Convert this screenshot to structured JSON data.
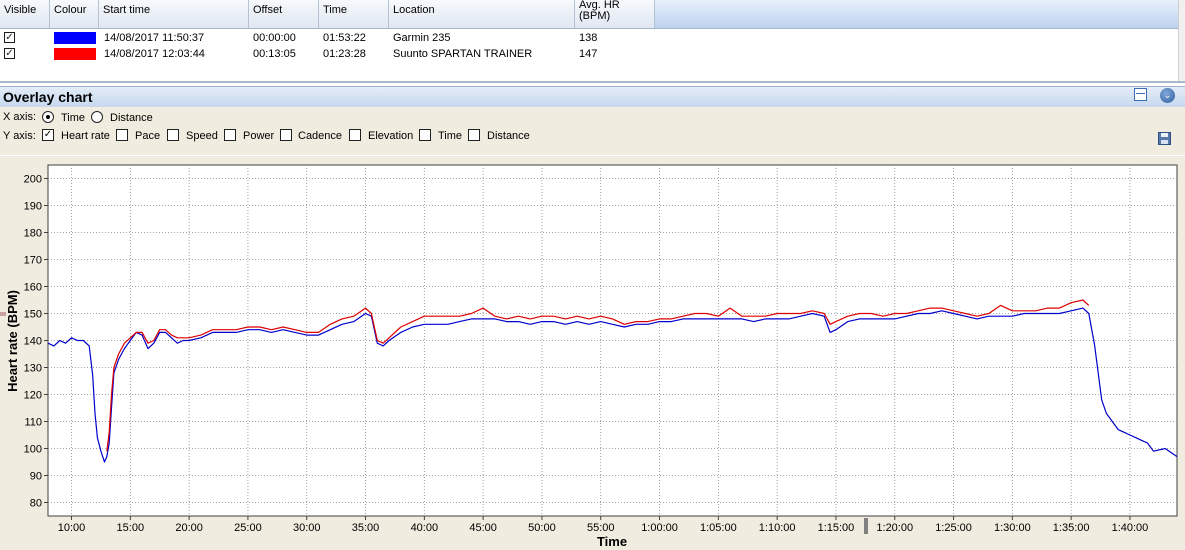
{
  "table": {
    "columns": [
      "Visible",
      "Colour",
      "Start time",
      "Offset",
      "Time",
      "Location",
      "Avg. HR\n(BPM)"
    ],
    "rows": [
      {
        "visible": true,
        "colour": "#0000ff",
        "start_time": "14/08/2017 11:50:37",
        "offset": "00:00:00",
        "time": "01:53:22",
        "location": "Garmin 235",
        "avg_hr": "138"
      },
      {
        "visible": true,
        "colour": "#ff0000",
        "start_time": "14/08/2017 12:03:44",
        "offset": "00:13:05",
        "time": "01:23:28",
        "location": "Suunto SPARTAN TRAINER",
        "avg_hr": "147"
      }
    ]
  },
  "panel": {
    "title": "Overlay chart",
    "x_axis_label": "X axis:",
    "x_axis_options": [
      {
        "label": "Time",
        "selected": true
      },
      {
        "label": "Distance",
        "selected": false
      }
    ],
    "y_axis_label": "Y axis:",
    "y_axis_options": [
      {
        "label": "Heart rate",
        "checked": true
      },
      {
        "label": "Pace",
        "checked": false
      },
      {
        "label": "Speed",
        "checked": false
      },
      {
        "label": "Power",
        "checked": false
      },
      {
        "label": "Cadence",
        "checked": false
      },
      {
        "label": "Elevation",
        "checked": false
      },
      {
        "label": "Time",
        "checked": false
      },
      {
        "label": "Distance",
        "checked": false
      }
    ],
    "icons": [
      "layout-icon",
      "collapse-icon",
      "save-icon"
    ]
  },
  "chart_data": {
    "type": "line",
    "xlabel": "Time",
    "ylabel": "Heart rate (BPM)",
    "xlim_min": [
      8,
      104
    ],
    "ylim": [
      75,
      205
    ],
    "y_ticks": [
      80,
      90,
      100,
      110,
      120,
      130,
      140,
      150,
      160,
      170,
      180,
      190,
      200
    ],
    "x_ticks": [
      {
        "v": 10,
        "label": "10:00"
      },
      {
        "v": 15,
        "label": "15:00"
      },
      {
        "v": 20,
        "label": "20:00"
      },
      {
        "v": 25,
        "label": "25:00"
      },
      {
        "v": 30,
        "label": "30:00"
      },
      {
        "v": 35,
        "label": "35:00"
      },
      {
        "v": 40,
        "label": "40:00"
      },
      {
        "v": 45,
        "label": "45:00"
      },
      {
        "v": 50,
        "label": "50:00"
      },
      {
        "v": 55,
        "label": "55:00"
      },
      {
        "v": 60,
        "label": "1:00:00"
      },
      {
        "v": 65,
        "label": "1:05:00"
      },
      {
        "v": 70,
        "label": "1:10:00"
      },
      {
        "v": 75,
        "label": "1:15:00"
      },
      {
        "v": 80,
        "label": "1:20:00"
      },
      {
        "v": 85,
        "label": "1:25:00"
      },
      {
        "v": 90,
        "label": "1:30:00"
      },
      {
        "v": 95,
        "label": "1:35:00"
      },
      {
        "v": 100,
        "label": "1:40:00"
      }
    ],
    "grid": true,
    "series": [
      {
        "color": "#0000cc",
        "points": [
          [
            8,
            139
          ],
          [
            8.5,
            138
          ],
          [
            9,
            140
          ],
          [
            9.5,
            139
          ],
          [
            10,
            141
          ],
          [
            10.5,
            140
          ],
          [
            11,
            140
          ],
          [
            11.5,
            138
          ],
          [
            11.8,
            127
          ],
          [
            12,
            113
          ],
          [
            12.2,
            104
          ],
          [
            12.5,
            99
          ],
          [
            12.8,
            95
          ],
          [
            13,
            97
          ],
          [
            13.2,
            102
          ],
          [
            13.4,
            115
          ],
          [
            13.6,
            128
          ],
          [
            14,
            133
          ],
          [
            14.5,
            137
          ],
          [
            15,
            140
          ],
          [
            15.5,
            143
          ],
          [
            16,
            142
          ],
          [
            16.5,
            137
          ],
          [
            17,
            139
          ],
          [
            17.5,
            143
          ],
          [
            18,
            143
          ],
          [
            18.5,
            141
          ],
          [
            19,
            139
          ],
          [
            19.5,
            140
          ],
          [
            20,
            140
          ],
          [
            21,
            141
          ],
          [
            22,
            143
          ],
          [
            23,
            143
          ],
          [
            24,
            143
          ],
          [
            25,
            144
          ],
          [
            26,
            144
          ],
          [
            27,
            143
          ],
          [
            28,
            144
          ],
          [
            29,
            143
          ],
          [
            30,
            142
          ],
          [
            31,
            142
          ],
          [
            32,
            144
          ],
          [
            33,
            146
          ],
          [
            34,
            147
          ],
          [
            35,
            150
          ],
          [
            35.5,
            149
          ],
          [
            36,
            139
          ],
          [
            36.5,
            138
          ],
          [
            37,
            140
          ],
          [
            38,
            143
          ],
          [
            39,
            145
          ],
          [
            40,
            146
          ],
          [
            41,
            146
          ],
          [
            42,
            146
          ],
          [
            43,
            147
          ],
          [
            44,
            148
          ],
          [
            45,
            148
          ],
          [
            46,
            148
          ],
          [
            47,
            147
          ],
          [
            48,
            147
          ],
          [
            49,
            146
          ],
          [
            50,
            147
          ],
          [
            51,
            147
          ],
          [
            52,
            146
          ],
          [
            53,
            147
          ],
          [
            54,
            146
          ],
          [
            55,
            147
          ],
          [
            56,
            146
          ],
          [
            57,
            145
          ],
          [
            58,
            146
          ],
          [
            59,
            146
          ],
          [
            60,
            147
          ],
          [
            61,
            147
          ],
          [
            62,
            148
          ],
          [
            63,
            148
          ],
          [
            64,
            148
          ],
          [
            65,
            148
          ],
          [
            66,
            148
          ],
          [
            67,
            148
          ],
          [
            68,
            147
          ],
          [
            69,
            148
          ],
          [
            70,
            148
          ],
          [
            71,
            148
          ],
          [
            72,
            149
          ],
          [
            73,
            150
          ],
          [
            74,
            149
          ],
          [
            74.5,
            143
          ],
          [
            75,
            144
          ],
          [
            76,
            147
          ],
          [
            77,
            148
          ],
          [
            78,
            148
          ],
          [
            79,
            148
          ],
          [
            80,
            148
          ],
          [
            81,
            149
          ],
          [
            82,
            150
          ],
          [
            83,
            150
          ],
          [
            84,
            151
          ],
          [
            85,
            150
          ],
          [
            86,
            149
          ],
          [
            87,
            148
          ],
          [
            88,
            149
          ],
          [
            89,
            149
          ],
          [
            90,
            149
          ],
          [
            91,
            150
          ],
          [
            92,
            150
          ],
          [
            93,
            150
          ],
          [
            94,
            150
          ],
          [
            95,
            151
          ],
          [
            96,
            152
          ],
          [
            96.5,
            150
          ],
          [
            97,
            138
          ],
          [
            97.3,
            128
          ],
          [
            97.6,
            118
          ],
          [
            98,
            113
          ],
          [
            98.5,
            110
          ],
          [
            99,
            107
          ],
          [
            99.5,
            106
          ],
          [
            100,
            105
          ],
          [
            100.5,
            104
          ],
          [
            101,
            103
          ],
          [
            101.5,
            102
          ],
          [
            102,
            99
          ],
          [
            103,
            100
          ],
          [
            104,
            97
          ]
        ]
      },
      {
        "color": "#dd0000",
        "points": [
          [
            13,
            99
          ],
          [
            13.2,
            106
          ],
          [
            13.4,
            120
          ],
          [
            13.6,
            130
          ],
          [
            14,
            135
          ],
          [
            14.5,
            139
          ],
          [
            15,
            141
          ],
          [
            15.5,
            143
          ],
          [
            16,
            143
          ],
          [
            16.5,
            139
          ],
          [
            17,
            140
          ],
          [
            17.5,
            144
          ],
          [
            18,
            144
          ],
          [
            18.5,
            142
          ],
          [
            19,
            141
          ],
          [
            19.5,
            141
          ],
          [
            20,
            141
          ],
          [
            21,
            142
          ],
          [
            22,
            144
          ],
          [
            23,
            144
          ],
          [
            24,
            144
          ],
          [
            25,
            145
          ],
          [
            26,
            145
          ],
          [
            27,
            144
          ],
          [
            28,
            145
          ],
          [
            29,
            144
          ],
          [
            30,
            143
          ],
          [
            31,
            143
          ],
          [
            32,
            146
          ],
          [
            33,
            148
          ],
          [
            34,
            149
          ],
          [
            35,
            152
          ],
          [
            35.5,
            150
          ],
          [
            36,
            140
          ],
          [
            36.5,
            139
          ],
          [
            37,
            141
          ],
          [
            38,
            145
          ],
          [
            39,
            147
          ],
          [
            40,
            149
          ],
          [
            41,
            149
          ],
          [
            42,
            149
          ],
          [
            43,
            149
          ],
          [
            44,
            150
          ],
          [
            45,
            152
          ],
          [
            46,
            149
          ],
          [
            47,
            148
          ],
          [
            48,
            149
          ],
          [
            49,
            148
          ],
          [
            50,
            149
          ],
          [
            51,
            149
          ],
          [
            52,
            148
          ],
          [
            53,
            149
          ],
          [
            54,
            148
          ],
          [
            55,
            149
          ],
          [
            56,
            148
          ],
          [
            57,
            146
          ],
          [
            58,
            147
          ],
          [
            59,
            147
          ],
          [
            60,
            148
          ],
          [
            61,
            148
          ],
          [
            62,
            149
          ],
          [
            63,
            150
          ],
          [
            64,
            150
          ],
          [
            65,
            149
          ],
          [
            66,
            152
          ],
          [
            67,
            149
          ],
          [
            68,
            149
          ],
          [
            69,
            149
          ],
          [
            70,
            150
          ],
          [
            71,
            150
          ],
          [
            72,
            150
          ],
          [
            73,
            151
          ],
          [
            74,
            150
          ],
          [
            74.5,
            146
          ],
          [
            75,
            147
          ],
          [
            76,
            149
          ],
          [
            77,
            150
          ],
          [
            78,
            150
          ],
          [
            79,
            149
          ],
          [
            80,
            150
          ],
          [
            81,
            150
          ],
          [
            82,
            151
          ],
          [
            83,
            152
          ],
          [
            84,
            152
          ],
          [
            85,
            151
          ],
          [
            86,
            150
          ],
          [
            87,
            149
          ],
          [
            88,
            150
          ],
          [
            89,
            153
          ],
          [
            90,
            151
          ],
          [
            91,
            151
          ],
          [
            92,
            151
          ],
          [
            93,
            152
          ],
          [
            94,
            152
          ],
          [
            95,
            154
          ],
          [
            96,
            155
          ],
          [
            96.5,
            153
          ]
        ]
      }
    ]
  }
}
